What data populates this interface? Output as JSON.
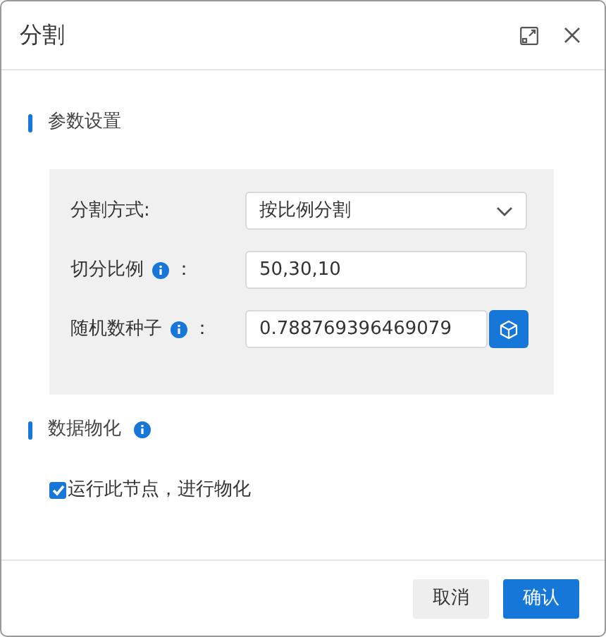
{
  "window": {
    "title": "分割"
  },
  "sections": [
    {
      "title": "参数设置",
      "info": false,
      "fields": [
        {
          "kind": "select",
          "label": "分割方式",
          "info": false,
          "colon": ":",
          "value": "按比例分割"
        },
        {
          "kind": "input",
          "label": "切分比例",
          "info": true,
          "colon": "：",
          "value": "50,30,10"
        },
        {
          "kind": "input_with_button",
          "label": "随机数种子",
          "info": true,
          "colon": "：",
          "value": "0.788769396469079"
        }
      ]
    },
    {
      "title": "数据物化",
      "info": true,
      "checkbox": {
        "label": "运行此节点，进行物化",
        "checked": true
      }
    }
  ],
  "buttons": [
    {
      "label": "取消",
      "kind": "secondary"
    },
    {
      "label": "确认",
      "kind": "primary"
    }
  ]
}
